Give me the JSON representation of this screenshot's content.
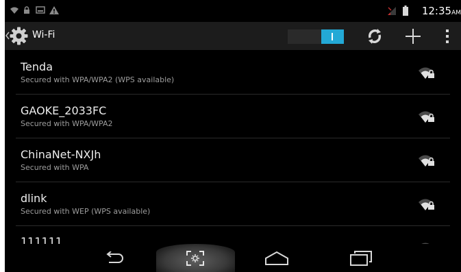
{
  "status_bar": {
    "time": "12:35",
    "ampm": "AM"
  },
  "action_bar": {
    "title": "Wi-Fi",
    "wifi_on": true
  },
  "networks": [
    {
      "ssid": "Tenda",
      "security": "Secured with WPA/WPA2 (WPS available)"
    },
    {
      "ssid": "GAOKE_2033FC",
      "security": "Secured with WPA/WPA2"
    },
    {
      "ssid": "ChinaNet-NXJh",
      "security": "Secured with WPA"
    },
    {
      "ssid": "dlink",
      "security": "Secured with WEP (WPS available)"
    },
    {
      "ssid": "111111",
      "security": ""
    }
  ],
  "icons": {
    "up": "back-arrow-icon",
    "settings": "settings-gear-icon",
    "wps": "wps-icon",
    "add": "add-network-icon",
    "overflow": "overflow-menu-icon",
    "nav_back": "back-icon",
    "nav_home": "home-icon",
    "nav_recents": "recent-apps-icon"
  },
  "colors": {
    "accent": "#23a9d6",
    "background": "#000000",
    "action_bar": "#1c1c1c"
  }
}
